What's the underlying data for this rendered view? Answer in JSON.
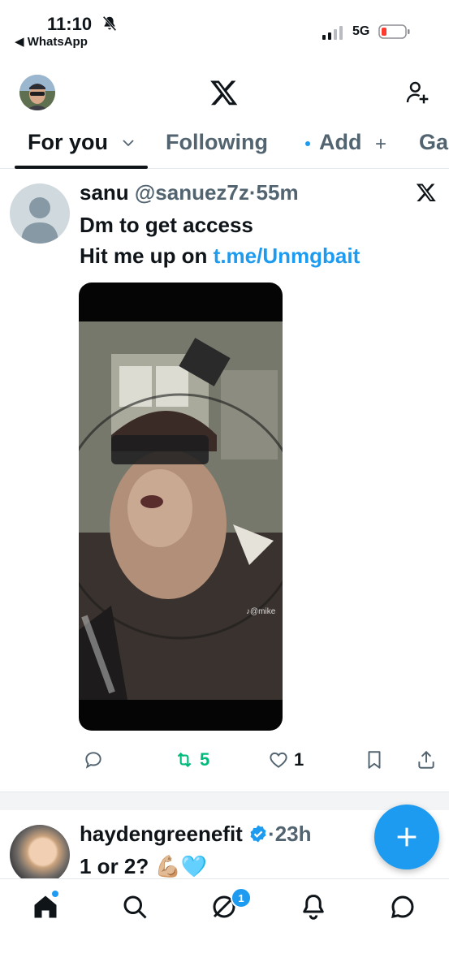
{
  "status_bar": {
    "time": "11:10",
    "back_app": "◀ WhatsApp",
    "network": "5G",
    "battery_color": "#ff3b30"
  },
  "tabs": [
    {
      "label": "For you",
      "active": true
    },
    {
      "label": "Following"
    },
    {
      "label": "Add"
    },
    {
      "label": "Ga"
    }
  ],
  "tweet": {
    "name": "sanu",
    "handle": "@sanuez7z",
    "time": "·55m",
    "line1": "Dm to get access",
    "line2_prefix": "Hit me up on ",
    "link": "t.me/Unmgbait",
    "watermark": "♪@mike",
    "stats": {
      "reposts": "5",
      "likes": "1"
    }
  },
  "tweet2": {
    "name": "haydengreenefit",
    "time": "·23h",
    "text": "1 or 2? 💪🏼🩵"
  },
  "nav": {
    "grok_badge": "1"
  },
  "colors": {
    "accent": "#1d9bf0",
    "repost": "#00ba7c",
    "text_secondary": "#536471"
  }
}
